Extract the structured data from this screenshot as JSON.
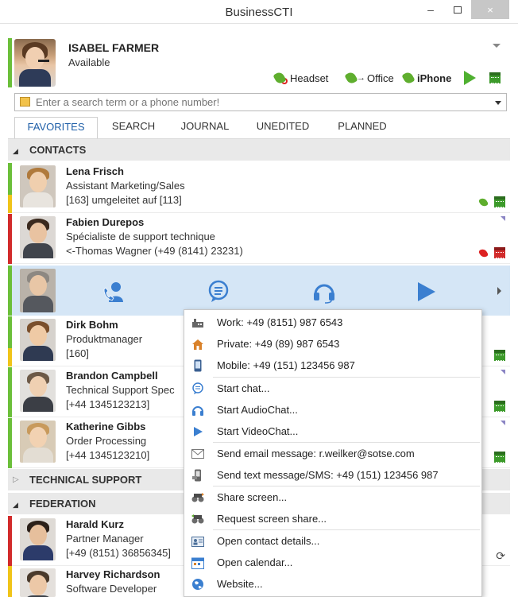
{
  "window": {
    "title": "BusinessCTI",
    "min_label": "–",
    "close_label": "×"
  },
  "user": {
    "name": "ISABEL FARMER",
    "status": "Available",
    "status_color": "#6bbf3a"
  },
  "devices": [
    {
      "label": "Headset"
    },
    {
      "label": "Office"
    },
    {
      "label": "iPhone"
    }
  ],
  "search": {
    "placeholder": "Enter a search term or a phone number!",
    "value": ""
  },
  "tabs": [
    {
      "label": "FAVORITES",
      "active": true
    },
    {
      "label": "SEARCH"
    },
    {
      "label": "JOURNAL"
    },
    {
      "label": "UNEDITED"
    },
    {
      "label": "PLANNED"
    }
  ],
  "groups": {
    "contacts": "CONTACTS",
    "technical_support": "TECHNICAL SUPPORT",
    "federation": "FEDERATION"
  },
  "contacts": [
    {
      "name": "Lena Frisch",
      "role": "Assistant Marketing/Sales",
      "info": "[163] umgeleitet auf [113]"
    },
    {
      "name": "Fabien Durepos",
      "role": "Spécialiste de support technique",
      "info": "<-Thomas Wagner (+49 (8141) 23231)"
    },
    {
      "name": "Dirk Bohm",
      "role": "Produktmanager",
      "info": "[160]"
    },
    {
      "name": "Brandon Campbell",
      "role": "Technical Support Spec",
      "info": "[+44 1345123213]"
    },
    {
      "name": "Katherine Gibbs",
      "role": "Order Processing",
      "info": "[+44 1345123210]"
    }
  ],
  "federation_contacts": [
    {
      "name": "Harald Kurz",
      "role": "Partner Manager",
      "info": "[+49 (8151) 36856345]"
    },
    {
      "name": "Harvey Richardson",
      "role": "Software Developer",
      "info": ""
    }
  ],
  "context_menu": {
    "items": [
      "Work: +49 (8151) 987 6543",
      "Private: +49 (89) 987 6543",
      "Mobile: +49 (151) 123456 987",
      "Start chat...",
      "Start AudioChat...",
      "Start VideoChat...",
      "Send email message: r.weilker@sotse.com",
      "Send text message/SMS: +49 (151) 123456 987",
      "Share screen...",
      "Request screen share...",
      "Open contact details...",
      "Open calendar...",
      "Website..."
    ]
  },
  "colors": {
    "accent_blue": "#3b7fd0",
    "present_green": "#6bbf3a",
    "busy_red": "#d22b2b",
    "away_yellow": "#f0c419",
    "selected_bg": "#d5e6f6"
  }
}
